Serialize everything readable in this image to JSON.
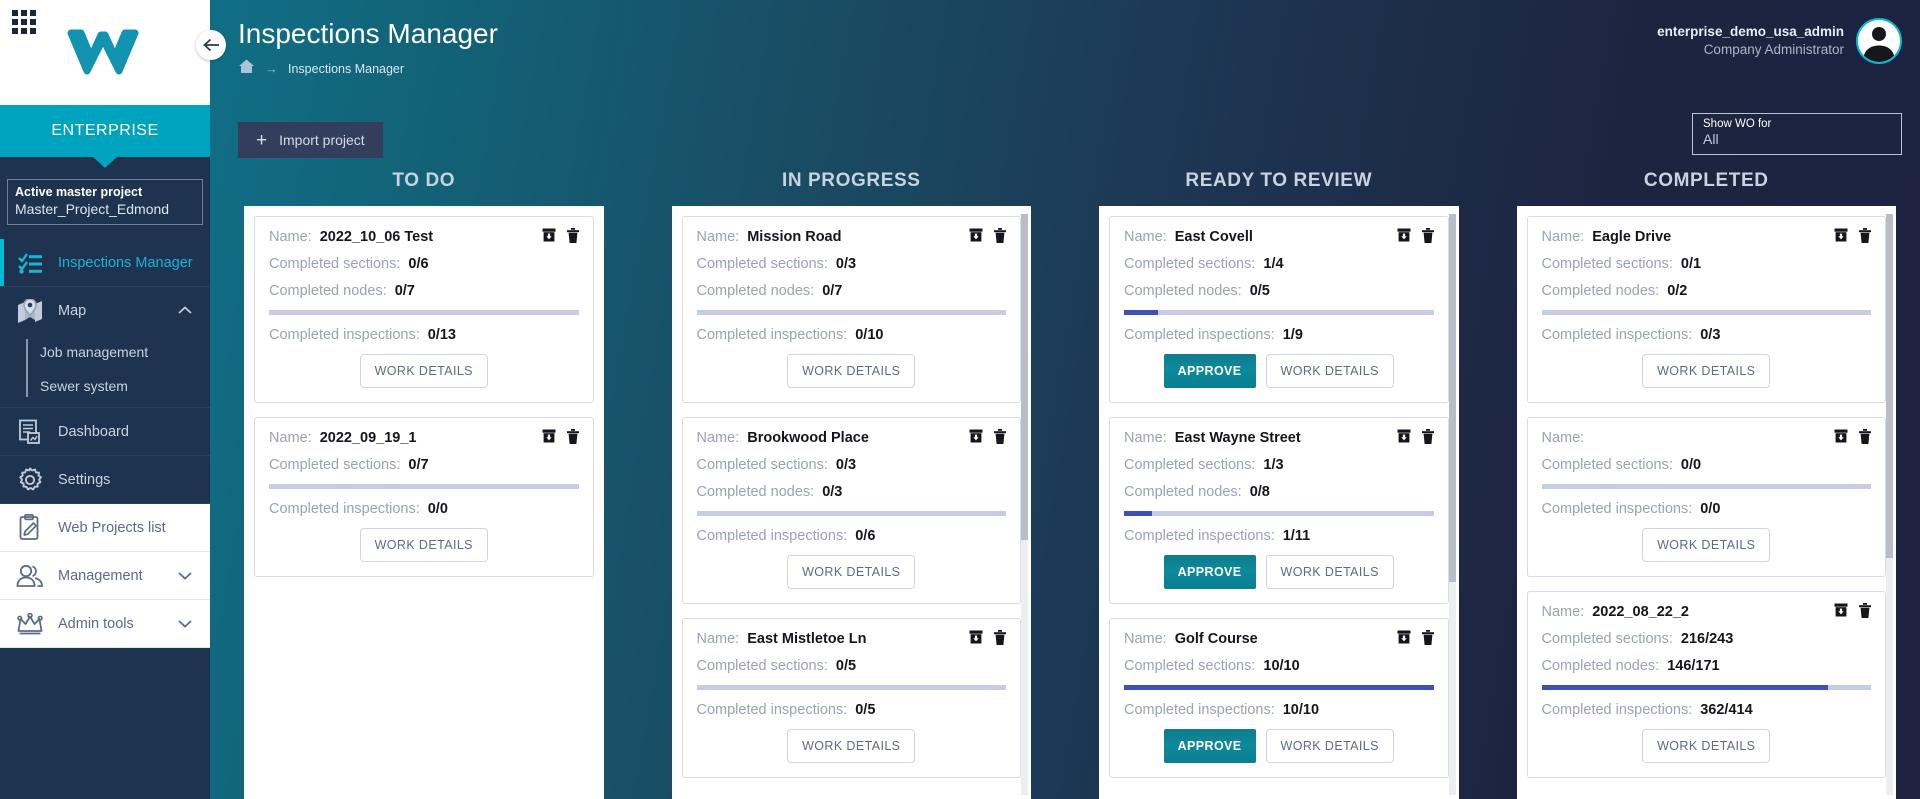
{
  "sidebar": {
    "brand": "ENTERPRISE",
    "active_project": {
      "label": "Active master project",
      "name": "Master_Project_Edmond"
    },
    "items": [
      {
        "label": "Inspections Manager",
        "icon": "checklist-icon"
      },
      {
        "label": "Map",
        "icon": "map-pin-icon",
        "chevron": "chevron-up-icon"
      },
      {
        "label": "Dashboard",
        "icon": "report-icon"
      },
      {
        "label": "Settings",
        "icon": "gear-icon"
      },
      {
        "label": "Web Projects list",
        "icon": "clipboard-pencil-icon"
      },
      {
        "label": "Management",
        "icon": "people-icon",
        "chevron": "chevron-down-icon"
      },
      {
        "label": "Admin tools",
        "icon": "crown-icon",
        "chevron": "chevron-down-icon"
      }
    ],
    "map_subitems": [
      {
        "label": "Job management"
      },
      {
        "label": "Sewer system"
      }
    ]
  },
  "header": {
    "title": "Inspections Manager",
    "breadcrumb_home": "home-icon",
    "breadcrumb_arrow": "→",
    "breadcrumb_current": "Inspections Manager",
    "user_name": "enterprise_demo_usa_admin",
    "user_role": "Company Administrator"
  },
  "toolbar": {
    "import_label": "Import project",
    "import_plus": "+",
    "wo_filter_label": "Show WO for",
    "wo_filter_value": "All"
  },
  "card_labels": {
    "name": "Name:",
    "sections": "Completed sections:",
    "nodes": "Completed nodes:",
    "inspections": "Completed inspections:",
    "approve": "APPROVE",
    "details": "WORK DETAILS",
    "archive_icon": "archive-box-icon",
    "delete_icon": "trash-icon"
  },
  "columns": [
    {
      "title": "TO DO",
      "cards": [
        {
          "name": "2022_10_06 Test",
          "sections": "0/6",
          "nodes": "0/7",
          "inspections": "0/13",
          "progress": 0,
          "approve": false
        },
        {
          "name": "2022_09_19_1",
          "sections": "0/7",
          "nodes": null,
          "inspections": "0/0",
          "progress": 0,
          "approve": false
        }
      ]
    },
    {
      "title": "IN PROGRESS",
      "cards": [
        {
          "name": "Mission Road",
          "sections": "0/3",
          "nodes": "0/7",
          "inspections": "0/10",
          "progress": 0,
          "approve": false
        },
        {
          "name": "Brookwood Place",
          "sections": "0/3",
          "nodes": "0/3",
          "inspections": "0/6",
          "progress": 0,
          "approve": false
        },
        {
          "name": "East Mistletoe Ln",
          "sections": "0/5",
          "nodes": null,
          "inspections": "0/5",
          "progress": 0,
          "approve": false
        }
      ]
    },
    {
      "title": "READY TO REVIEW",
      "cards": [
        {
          "name": "East Covell",
          "sections": "1/4",
          "nodes": "0/5",
          "inspections": "1/9",
          "progress": 11,
          "approve": true
        },
        {
          "name": "East Wayne Street",
          "sections": "1/3",
          "nodes": "0/8",
          "inspections": "1/11",
          "progress": 9,
          "approve": true
        },
        {
          "name": "Golf Course",
          "sections": "10/10",
          "nodes": null,
          "inspections": "10/10",
          "progress": 100,
          "approve": true
        }
      ]
    },
    {
      "title": "COMPLETED",
      "cards": [
        {
          "name": "Eagle Drive",
          "sections": "0/1",
          "nodes": "0/2",
          "inspections": "0/3",
          "progress": 0,
          "approve": false
        },
        {
          "name": "",
          "sections": "0/0",
          "nodes": null,
          "inspections": "0/0",
          "progress": 0,
          "approve": false
        },
        {
          "name": "2022_08_22_2",
          "sections": "216/243",
          "nodes": "146/171",
          "inspections": "362/414",
          "progress": 87,
          "approve": false
        }
      ]
    }
  ],
  "colors": {
    "accent_cyan": "#00bcd4",
    "sidebar_navy": "#1d3350",
    "progress_blue": "#3f51b5",
    "approve_teal": "#0c8a9b"
  }
}
